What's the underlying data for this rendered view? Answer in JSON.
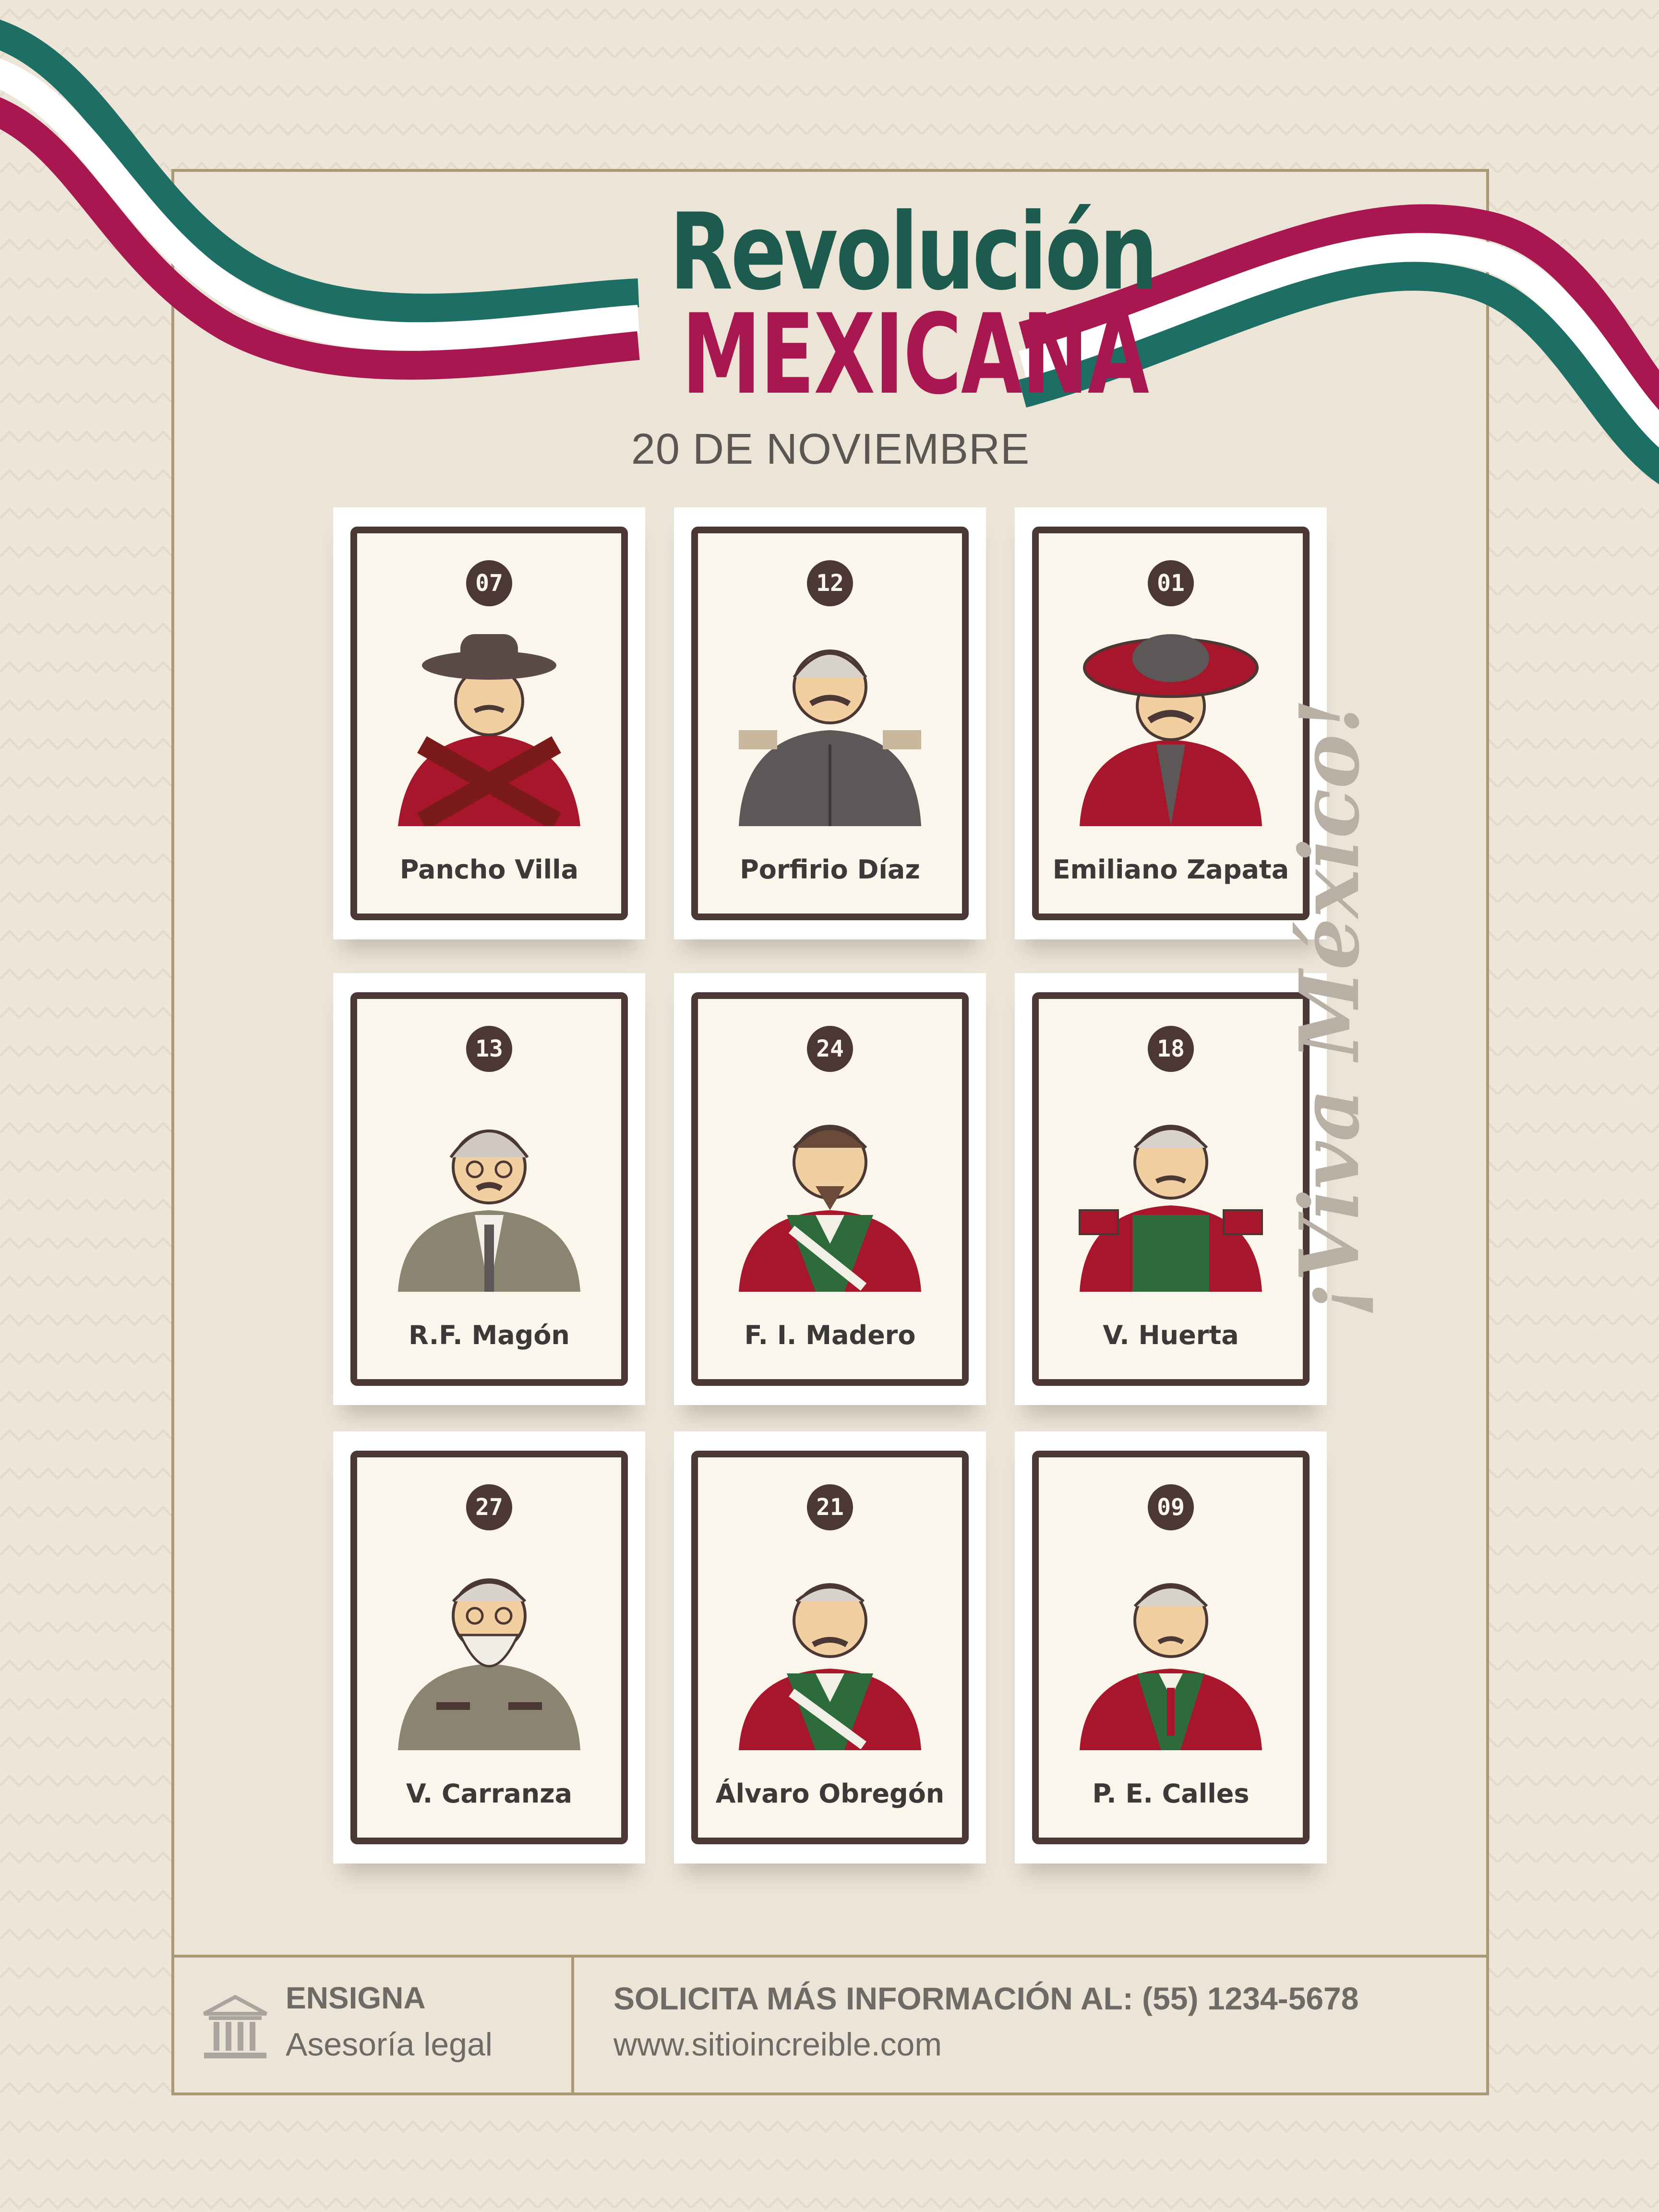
{
  "title": {
    "line1": "Revolución",
    "line2": "MEXICANA",
    "date": "20 DE NOVIEMBRE"
  },
  "colors": {
    "green": "#1d5b4e",
    "magenta": "#a8174f",
    "frame": "#a89977",
    "card_border": "#4b3835"
  },
  "cards": [
    {
      "number": "07",
      "name": "Pancho Villa"
    },
    {
      "number": "12",
      "name": "Porfirio Díaz"
    },
    {
      "number": "01",
      "name": "Emiliano Zapata"
    },
    {
      "number": "13",
      "name": "R.F. Magón"
    },
    {
      "number": "24",
      "name": "F. I. Madero"
    },
    {
      "number": "18",
      "name": "V. Huerta"
    },
    {
      "number": "27",
      "name": "V. Carranza"
    },
    {
      "number": "21",
      "name": "Álvaro Obregón"
    },
    {
      "number": "09",
      "name": "P. E. Calles"
    }
  ],
  "side_text": "¡Viva México!",
  "footer": {
    "brand": "ENSIGNA",
    "tagline": "Asesoría legal",
    "info": "SOLICITA MÁS INFORMACIÓN AL: (55) 1234-5678",
    "website": "www.sitioincreible.com",
    "icon": "bank-building-icon"
  }
}
